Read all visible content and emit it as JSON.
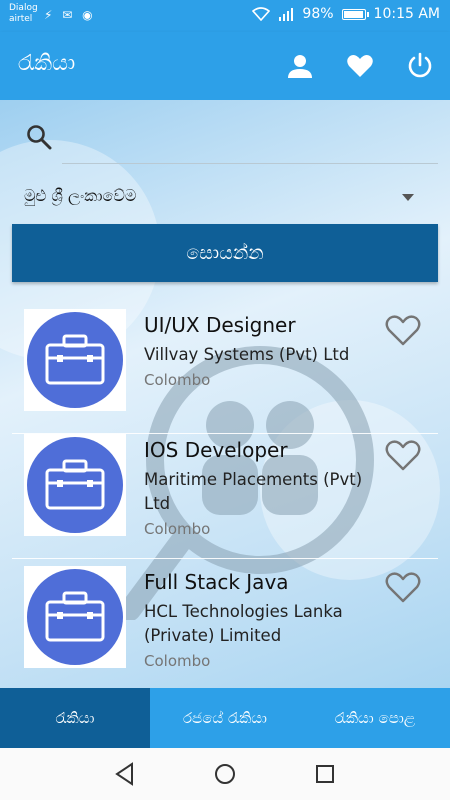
{
  "status_bar": {
    "carrier_line1": "Dialog",
    "carrier_line2": "airtel",
    "notification_icons": "⚡ ✉ ◉",
    "battery": "98%",
    "battery_level": 0.98,
    "time": "10:15 AM"
  },
  "app_bar": {
    "title": "රැකියා",
    "icons": [
      "person-icon",
      "heart-icon",
      "power-icon"
    ]
  },
  "search": {
    "placeholder": "",
    "value": ""
  },
  "location": {
    "selected": "මුළු ශ්‍රී ලංකාවේම"
  },
  "search_button": {
    "label": "සොයන්න"
  },
  "jobs": [
    {
      "title": "UI/UX Designer",
      "company": "Villvay Systems (Pvt) Ltd",
      "location": "Colombo"
    },
    {
      "title": "IOS Developer",
      "company": "Maritime Placements (Pvt) Ltd",
      "location": "Colombo"
    },
    {
      "title": "Full Stack Java",
      "company": "HCL Technologies Lanka (Private) Limited",
      "location": "Colombo"
    }
  ],
  "tabs": [
    {
      "label": "රැකියා",
      "active": true
    },
    {
      "label": "රජයේ රැකියා",
      "active": false
    },
    {
      "label": "රැකියා පොළ",
      "active": false
    }
  ],
  "colors": {
    "primary": "#2da0e8",
    "primary_dark": "#0f5f97",
    "thumb_blue": "#4f6ed8"
  }
}
